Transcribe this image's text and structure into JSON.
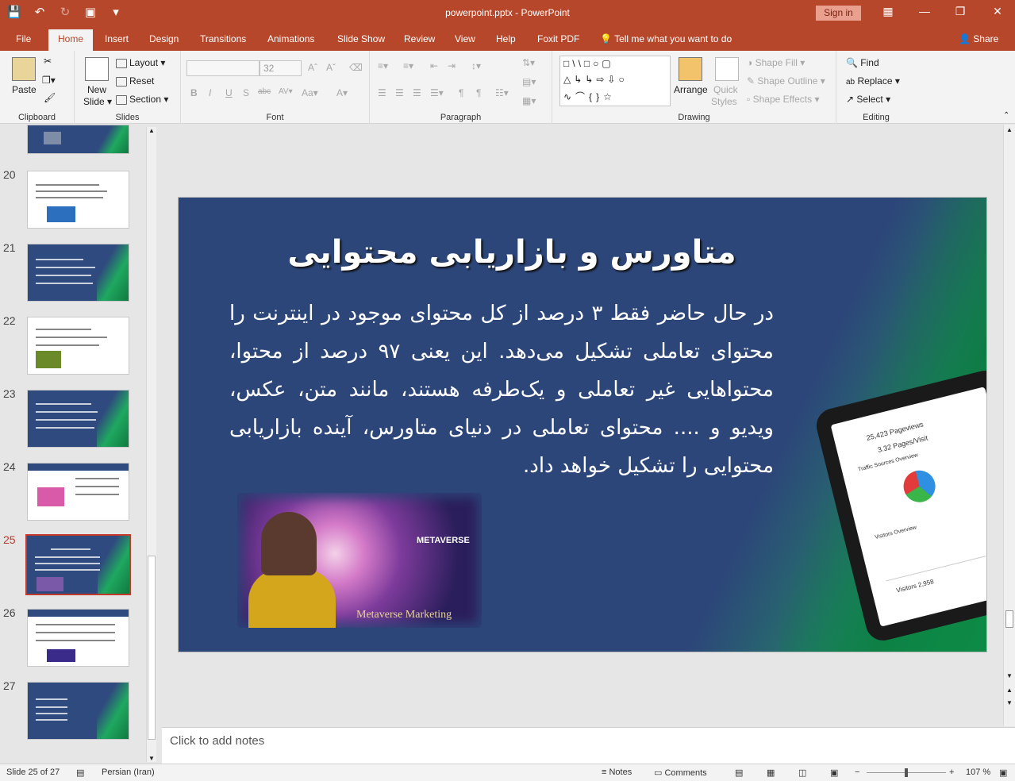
{
  "window": {
    "title": "powerpoint.pptx  -  PowerPoint",
    "signin": "Sign in"
  },
  "tabs": [
    {
      "label": "File"
    },
    {
      "label": "Home"
    },
    {
      "label": "Insert"
    },
    {
      "label": "Design"
    },
    {
      "label": "Transitions"
    },
    {
      "label": "Animations"
    },
    {
      "label": "Slide Show"
    },
    {
      "label": "Review"
    },
    {
      "label": "View"
    },
    {
      "label": "Help"
    },
    {
      "label": "Foxit PDF"
    }
  ],
  "tellme": "Tell me what you want to do",
  "share": "Share",
  "ribbon": {
    "clipboard": {
      "paste": "Paste",
      "label": "Clipboard"
    },
    "slides": {
      "new_slide": "New",
      "new_slide2": "Slide",
      "layout": "Layout",
      "reset": "Reset",
      "section": "Section",
      "label": "Slides"
    },
    "font": {
      "size": "32",
      "label": "Font"
    },
    "paragraph": {
      "label": "Paragraph"
    },
    "drawing": {
      "arrange": "Arrange",
      "quick_styles": "Quick",
      "quick_styles2": "Styles",
      "shape_fill": "Shape Fill",
      "shape_outline": "Shape Outline",
      "shape_effects": "Shape Effects",
      "label": "Drawing"
    },
    "editing": {
      "find": "Find",
      "replace": "Replace",
      "select": "Select",
      "label": "Editing"
    }
  },
  "thumbnails": [
    {
      "num": "20"
    },
    {
      "num": "21"
    },
    {
      "num": "22"
    },
    {
      "num": "23"
    },
    {
      "num": "24"
    },
    {
      "num": "25"
    },
    {
      "num": "26"
    },
    {
      "num": "27"
    }
  ],
  "slide": {
    "title": "متاورس و بازاریابی محتوایی",
    "body": "در حال حاضر فقط ۳ درصد از کل محتوای موجود در اینترنت را محتوای تعاملی تشکیل می‌دهد. این یعنی ۹۷ درصد از محتوا، محتواهایی غیر تعاملی و یک‌طرفه هستند، مانند متن، عکس، ویدیو و .... محتوای تعاملی در دنیای متاورس، آینده بازاریابی محتوایی را تشکیل خواهد داد.",
    "photo_text": "METAVERSE",
    "photo_caption": "Metaverse Marketing",
    "tablet": {
      "t1": "25,423 Pageviews",
      "t2": "3.32 Pages/Visit",
      "t3": "Traffic Sources Overview",
      "t4": "Visitors Overview",
      "t5": "Visitors 2,958"
    }
  },
  "notes_placeholder": "Click to add notes",
  "status": {
    "slide": "Slide 25 of 27",
    "language": "Persian (Iran)",
    "notes": "Notes",
    "comments": "Comments",
    "zoom": "107 %"
  }
}
